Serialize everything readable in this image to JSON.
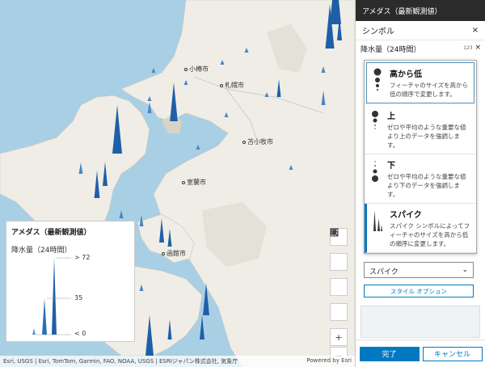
{
  "map": {
    "cities": [
      {
        "name": "小樽市"
      },
      {
        "name": "札幌市"
      },
      {
        "name": "苫小牧市"
      },
      {
        "name": "室蘭市"
      },
      {
        "name": "函館市"
      }
    ],
    "attribution": "Esri, USGS | Esri, TomTom, Garmin, FAO, NOAA, USGS | ESRIジャパン株式会社, 気象庁",
    "powered_by": "Powered by Esri",
    "tools": {
      "search": "search-icon",
      "layers": "layers-icon",
      "screen": "screen-icon",
      "home": "home-icon",
      "zoom_in": "+",
      "zoom_out": "−"
    }
  },
  "legend": {
    "title": "アメダス（最新観測値）",
    "subtitle": "降水量（24時間）",
    "max_label": "> 72",
    "mid_label": "35",
    "min_label": "< 0"
  },
  "panel": {
    "header": "アメダス（最新観測値）",
    "section_title": "シンボル",
    "close": "×",
    "field_label": "降水量（24時間）",
    "field_count": "123",
    "field_close": "×",
    "options": [
      {
        "id": "high-to-low",
        "title": "高から低",
        "desc": "フィーチャのサイズを高から低の順序で変更します。"
      },
      {
        "id": "above",
        "title": "上",
        "desc": "ゼロや平均のような重要な値より上のデータを強調します。"
      },
      {
        "id": "below",
        "title": "下",
        "desc": "ゼロや平均のような重要な値より下のデータを強調します。"
      },
      {
        "id": "spike",
        "title": "スパイク",
        "desc": "スパイク シンボルによってフィーチャのサイズを高から低の順序に変更します。"
      }
    ],
    "selected_value": "スパイク",
    "style_options": "スタイル オプション",
    "done": "完了",
    "cancel": "キャンセル"
  },
  "colors": {
    "accent": "#0079c1",
    "header_bg": "#2b2b2b",
    "water": "#a9cfe4",
    "land": "#efede6"
  }
}
